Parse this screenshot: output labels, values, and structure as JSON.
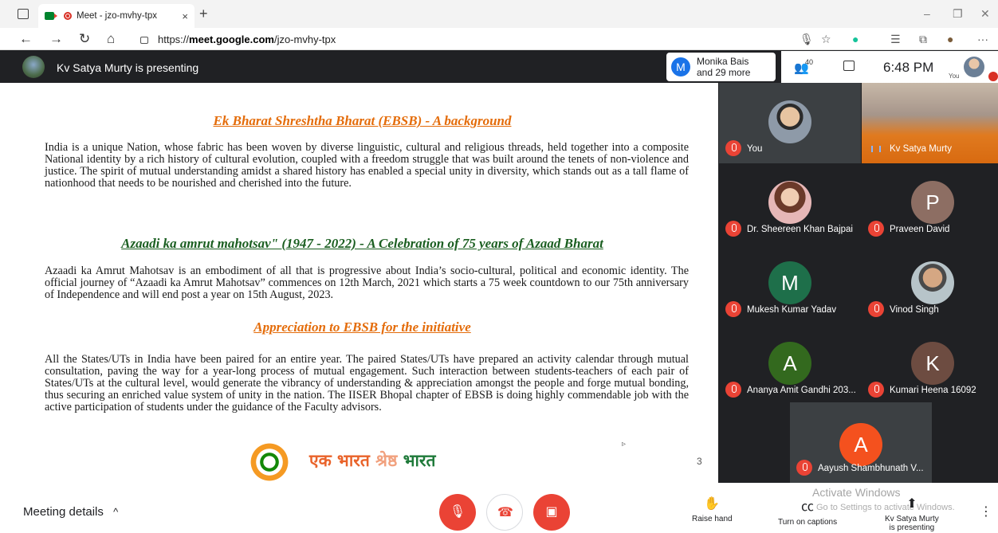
{
  "browser": {
    "tab_title": "Meet - jzo-mvhy-tpx",
    "tab_close": "×",
    "new_tab": "+",
    "url_scheme": "https://",
    "url_host": "meet.google.com",
    "url_path": "/jzo-mvhy-tpx",
    "minimize": "–",
    "restore": "❐",
    "close": "✕",
    "back": "←",
    "forward": "→",
    "reload": "↻",
    "home": "⌂",
    "more": "···"
  },
  "meet_header": {
    "presenting_text": "Kv Satya Murty is presenting",
    "speaker_initial": "M",
    "speaker_line1": "Monika Bais",
    "speaker_line2": "and 29 more",
    "participant_count": "40",
    "time": "6:48 PM",
    "self_label": "You"
  },
  "slide": {
    "heading1": "Ek Bharat Shreshtha Bharat (EBSB) - A background",
    "para1": "India is a unique Nation, whose fabric has been woven by diverse linguistic, cultural and religious threads, held together into a composite National identity by a rich history of cultural evolution, coupled with a freedom struggle that was built around the tenets of non-violence and justice. The spirit of mutual understanding amidst a shared history has enabled a special unity in diversity, which stands out as a tall flame of nationhood that needs to be nourished and cherished into the future.",
    "heading2": "Azaadi ka amrut mahotsav\" (1947 - 2022) - A Celebration of 75 years of Azaad Bharat",
    "para2": "Azaadi ka Amrut Mahotsav is an embodiment of all that is progressive about India’s socio-cultural, political and economic identity. The official journey of “Azaadi ka Amrut Mahotsav” commences on 12th March, 2021 which starts a 75 week countdown to our 75th anniversary of Independence and will end post a year on 15th August, 2023.",
    "heading3": "Appreciation to EBSB for the initiative",
    "para3": "All the States/UTs in India have been paired for an entire year. The paired States/UTs have prepared an activity calendar through mutual consultation, paving the way for a year-long process of mutual engagement. Such interaction between students-teachers of each pair of States/UTs at the cultural level, would generate the vibrancy of understanding & appreciation amongst the people and forge mutual bonding, thus securing an enriched value system of unity in the nation. The IISER Bhopal chapter of EBSB is doing highly commendable job with the active participation of students under the guidance of the Faculty advisors.",
    "logo_word1": "एक भारत",
    "logo_word2": "श्रेष्ठ",
    "logo_word3": "भारत",
    "page_number": "3"
  },
  "participants": [
    {
      "name": "You",
      "initial": ""
    },
    {
      "name": "Kv Satya Murty",
      "initial": ""
    },
    {
      "name": "Dr. Sheereen Khan Bajpai",
      "initial": ""
    },
    {
      "name": "Praveen David",
      "initial": "P",
      "color": "#8d6e63"
    },
    {
      "name": "Mukesh Kumar Yadav",
      "initial": "M",
      "color": "#1e6f4a"
    },
    {
      "name": "Vinod Singh",
      "initial": ""
    },
    {
      "name": "Ananya Amit Gandhi 203...",
      "initial": "A",
      "color": "#33691e"
    },
    {
      "name": "Kumari Heena 16092",
      "initial": "K",
      "color": "#6d4c41"
    },
    {
      "name": "Aayush Shambhunath V...",
      "initial": "A",
      "color": "#f4511e"
    }
  ],
  "bottom": {
    "meeting_details": "Meeting details",
    "chevron": "^",
    "raise_hand": "Raise hand",
    "captions": "Turn on captions",
    "presenting_line1": "Kv Satya Murty",
    "presenting_line2": "is presenting",
    "activate_title": "Activate Windows",
    "activate_sub": "Go to Settings to activate Windows.",
    "more": "⋮"
  },
  "colors": {
    "meet_dark": "#202124",
    "end_call_red": "#ea4335",
    "heading_orange": "#e46c0a",
    "heading_green": "#1a5e20"
  }
}
